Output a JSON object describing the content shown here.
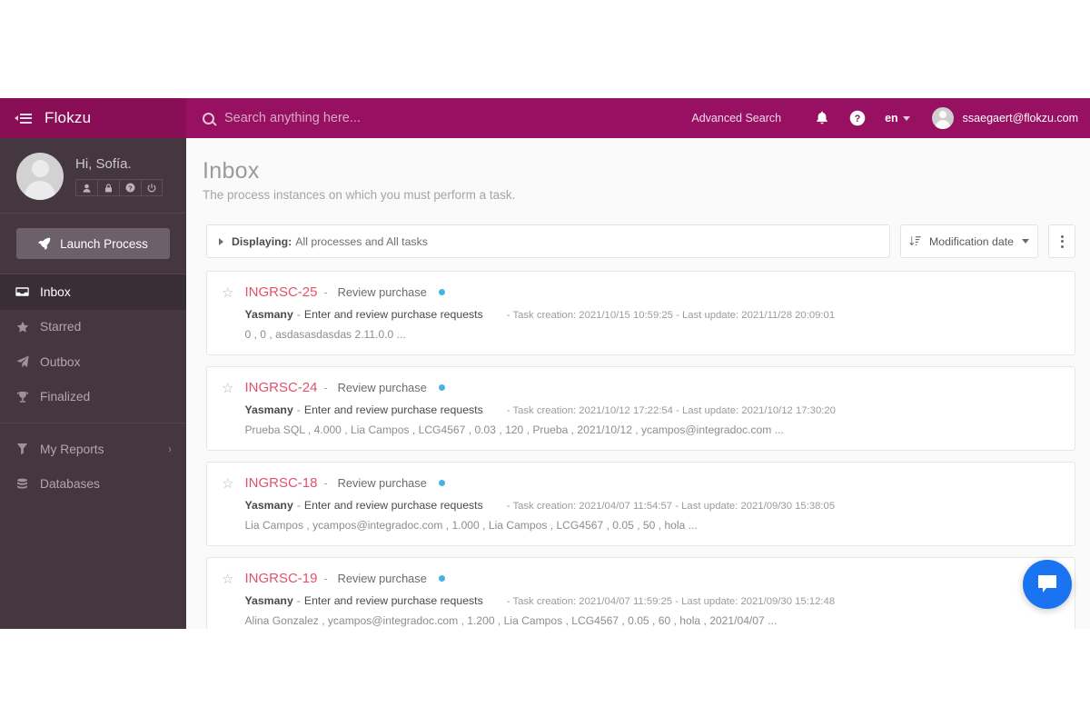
{
  "topbar": {
    "collapse_icon": "collapse-menu-icon",
    "brand": "Flokzu",
    "search_icon": "search-icon",
    "search_placeholder": "Search anything here...",
    "search_value": "",
    "advanced_search": "Advanced Search",
    "bell_icon": "bell-icon",
    "help_icon": "help-circle-icon",
    "language": "en",
    "user_email": "ssaegaert@flokzu.com",
    "brand_bg": "#8a0e56",
    "bar_bg": "#971061"
  },
  "sidebar": {
    "greeting": "Hi, Sofía.",
    "mini_buttons": [
      {
        "name": "profile-icon"
      },
      {
        "name": "lock-icon"
      },
      {
        "name": "help-icon"
      },
      {
        "name": "power-icon"
      }
    ],
    "launch_label": "Launch Process",
    "items": [
      {
        "label": "Inbox",
        "icon": "inbox-icon",
        "active": true
      },
      {
        "label": "Starred",
        "icon": "star-icon",
        "active": false
      },
      {
        "label": "Outbox",
        "icon": "paper-plane-icon",
        "active": false
      },
      {
        "label": "Finalized",
        "icon": "trophy-icon",
        "active": false
      }
    ],
    "items2": [
      {
        "label": "My Reports",
        "icon": "funnel-chart-icon",
        "chevron": "›"
      },
      {
        "label": "Databases",
        "icon": "database-icon",
        "chevron": ""
      }
    ],
    "bg": "#453740",
    "active_bg": "#3a2e36"
  },
  "main": {
    "title": "Inbox",
    "subtitle": "The process instances on which you must perform a task.",
    "toolbar": {
      "displaying_label": "Displaying:",
      "displaying_value": "All processes and All tasks",
      "sort_label": "Modification date",
      "sort_icon": "sort-descending-icon",
      "kebab_icon": "kebab-menu-icon"
    },
    "cards": [
      {
        "code": "INGRSC-25",
        "separator": "-",
        "task": "Review purchase",
        "status_dot_color": "#44b4e4",
        "assignee": "Yasmany",
        "process": "Enter and review purchase requests",
        "meta": "- Task creation: 2021/10/15 10:59:25 - Last update: 2021/11/28 20:09:01",
        "preview": "0 , 0 , asdasasdasdas 2.11.0.0 ..."
      },
      {
        "code": "INGRSC-24",
        "separator": "-",
        "task": "Review purchase",
        "status_dot_color": "#44b4e4",
        "assignee": "Yasmany",
        "process": "Enter and review purchase requests",
        "meta": "- Task creation: 2021/10/12 17:22:54 - Last update: 2021/10/12 17:30:20",
        "preview": "Prueba SQL , 4.000 , Lia Campos , LCG4567 , 0.03 , 120 , Prueba , 2021/10/12 , ycampos@integradoc.com ..."
      },
      {
        "code": "INGRSC-18",
        "separator": "-",
        "task": "Review purchase",
        "status_dot_color": "#44b4e4",
        "assignee": "Yasmany",
        "process": "Enter and review purchase requests",
        "meta": "- Task creation: 2021/04/07 11:54:57 - Last update: 2021/09/30 15:38:05",
        "preview": "Lia Campos , ycampos@integradoc.com , 1.000 , Lia Campos , LCG4567 , 0.05 , 50 , hola ..."
      },
      {
        "code": "INGRSC-19",
        "separator": "-",
        "task": "Review purchase",
        "status_dot_color": "#44b4e4",
        "assignee": "Yasmany",
        "process": "Enter and review purchase requests",
        "meta": "- Task creation: 2021/04/07 11:59:25 - Last update: 2021/09/30 15:12:48",
        "preview": "Alina Gonzalez , ycampos@integradoc.com , 1.200 , Lia Campos , LCG4567 , 0.05 , 60 , hola , 2021/04/07 ..."
      }
    ]
  },
  "chat": {
    "icon": "chat-bubble-icon",
    "color": "#1a73f0"
  }
}
